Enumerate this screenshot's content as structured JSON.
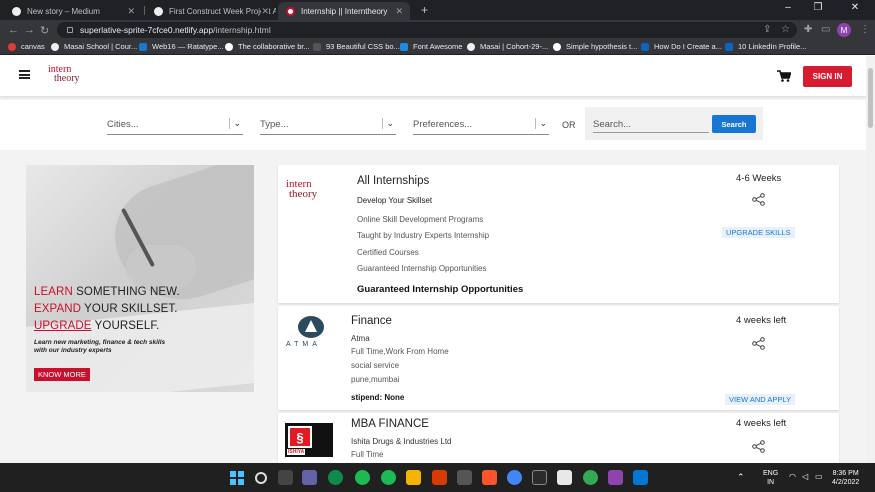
{
  "browser": {
    "tabs": [
      {
        "title": "New story – Medium",
        "active": false
      },
      {
        "title": "First Construct Week Project At M",
        "active": false
      },
      {
        "title": "Internship || Interntheory",
        "active": true
      }
    ],
    "new_tab": "+",
    "window_controls": [
      "–",
      "❐",
      "✕"
    ],
    "url": {
      "host": "superlative-sprite-7cfce0.netlify.app",
      "path": "/internship.html"
    },
    "profile_initial": "M",
    "bookmarks": [
      "canvas",
      "Masai School | Cour...",
      "Web16 — Ratatype...",
      "The collaborative br...",
      "93 Beautiful CSS bo...",
      "Font Awesome",
      "Masai | Cohort-29-...",
      "Simple hypothesis t...",
      "How Do I Create a...",
      "10 LinkedIn Profile..."
    ]
  },
  "site": {
    "logo": {
      "line1": "intern",
      "line2": "theory"
    },
    "signin_label": "SIGN IN",
    "filters": {
      "cities": "Cities...",
      "type": "Type...",
      "preferences": "Preferences...",
      "or": "OR",
      "search_placeholder": "Search...",
      "search_button": "Search"
    },
    "promo": {
      "line1_red": "LEARN",
      "line1_rest": " SOMETHING NEW.",
      "line2_red": "EXPAND",
      "line2_rest": " YOUR SKILLSET.",
      "line3_red": "UPGRADE",
      "line3_rest": " YOURSELF.",
      "subtitle": "Learn new marketing, finance & tech skills with our industry experts",
      "cta": "KNOW MORE"
    },
    "cards": [
      {
        "title": "All Internships",
        "subtitle": "Develop Your Skillset",
        "points": [
          "Online Skill Development Programs",
          "Taught by Industry Experts Internship",
          "Certified Courses",
          "Guaranteed Internship Opportunities"
        ],
        "footer": "Guaranteed Internship Opportunities",
        "duration": "4-6 Weeks",
        "action": "UPGRADE SKILLS"
      },
      {
        "title": "Finance",
        "company": "Atma",
        "mode": "Full Time,Work From Home",
        "category": "social service",
        "location": "pune,mumbai",
        "stipend": "stipend: None",
        "duration": "4 weeks left",
        "action": "VIEW AND APPLY",
        "logo_text": "ATMA"
      },
      {
        "title": "MBA FINANCE",
        "company": "Ishita Drugs & Industries Ltd",
        "mode": "Full Time",
        "duration": "4 weeks left",
        "logo_text": "ISHIYA"
      }
    ]
  },
  "taskbar": {
    "lang": "ENG",
    "region": "IN",
    "time": "8:36 PM",
    "date": "4/2/2022"
  },
  "colors": {
    "brand_red": "#d81b30",
    "link_blue": "#1976d2",
    "chrome_dark": "#202124"
  }
}
